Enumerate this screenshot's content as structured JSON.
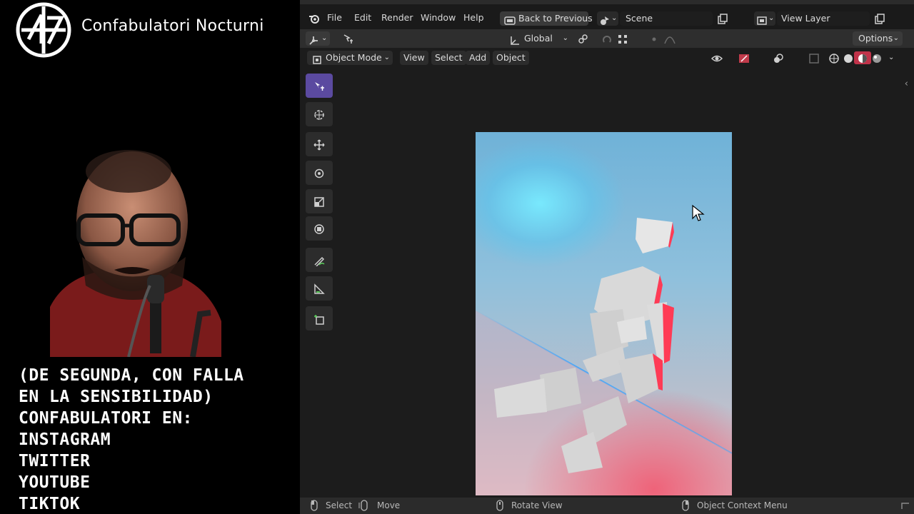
{
  "overlay": {
    "channel_name": "Confabulatori Nocturni",
    "lines": [
      "(DE SEGUNDA, CON FALLA",
      "EN LA SENSIBILIDAD)",
      "CONFABULATORI EN:",
      "INSTAGRAM",
      "TWITTER",
      "YOUTUBE",
      "TIKTOK"
    ]
  },
  "menu": {
    "items": [
      "File",
      "Edit",
      "Render",
      "Window",
      "Help"
    ],
    "back_label": "Back to Previous",
    "scene_label": "Scene",
    "view_layer_label": "View Layer"
  },
  "tool_header": {
    "orientation": "Global",
    "options_label": "Options"
  },
  "viewport_header": {
    "mode": "Object Mode",
    "menus": [
      "View",
      "Select",
      "Add",
      "Object"
    ]
  },
  "toolbar": {
    "tools": [
      "select-box-icon",
      "cursor-icon",
      "move-icon",
      "rotate-icon",
      "scale-icon",
      "transform-icon",
      "annotate-icon",
      "measure-icon",
      "add-cube-icon"
    ]
  },
  "status_bar": {
    "items": [
      "Select",
      "Move",
      "Rotate View",
      "Object Context Menu"
    ]
  },
  "colors": {
    "active_tool": "#5b4aa0",
    "viewport_bg": "#1c1c1c",
    "header_bg": "#2e2e2e"
  }
}
